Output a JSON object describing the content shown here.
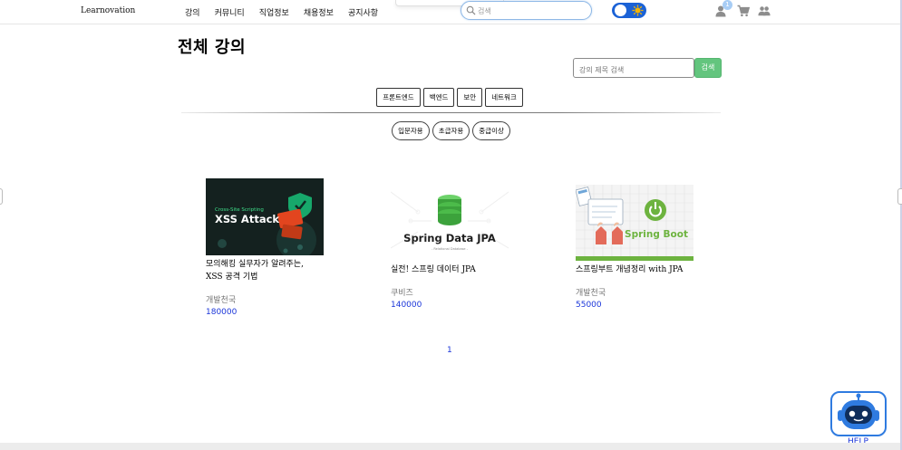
{
  "nav": {
    "brand": "Learnovation",
    "menu": [
      {
        "label": "강의"
      },
      {
        "label": "커뮤니티"
      },
      {
        "label": "직업정보"
      },
      {
        "label": "채용정보"
      },
      {
        "label": "공지사항"
      }
    ],
    "search_placeholder": "검색",
    "cart_badge": "1"
  },
  "page": {
    "title": "전체 강의",
    "search_placeholder": "강의 제목 검색",
    "search_button": "검색"
  },
  "categories": [
    "프론트엔드",
    "백엔드",
    "보안",
    "네트워크"
  ],
  "levels": [
    "입문자용",
    "초급자용",
    "중급이상"
  ],
  "courses": [
    {
      "thumb_small_text": "Cross-Site Scripting",
      "thumb_title": "XSS Attack",
      "title": "모의해킹 실무자가 알려주는, XSS 공격 기법",
      "instructor": "개발천국",
      "price": "180000"
    },
    {
      "thumb_title": "Spring Data JPA",
      "thumb_sub": "- Relational Database -",
      "title": "실전! 스프링 데이터 JPA",
      "instructor": "쿠비즈",
      "price": "140000"
    },
    {
      "thumb_title": "Spring Boot",
      "title": "스프링부트 개념정리 with JPA",
      "instructor": "개발천국",
      "price": "55000"
    }
  ],
  "pagination": {
    "current": "1"
  },
  "chatbot": {
    "label": "HELP"
  },
  "colors": {
    "accent_blue": "#1b62d6",
    "price_blue": "#1a35d9",
    "search_green": "#63c57e",
    "spring_green": "#6db33f"
  }
}
